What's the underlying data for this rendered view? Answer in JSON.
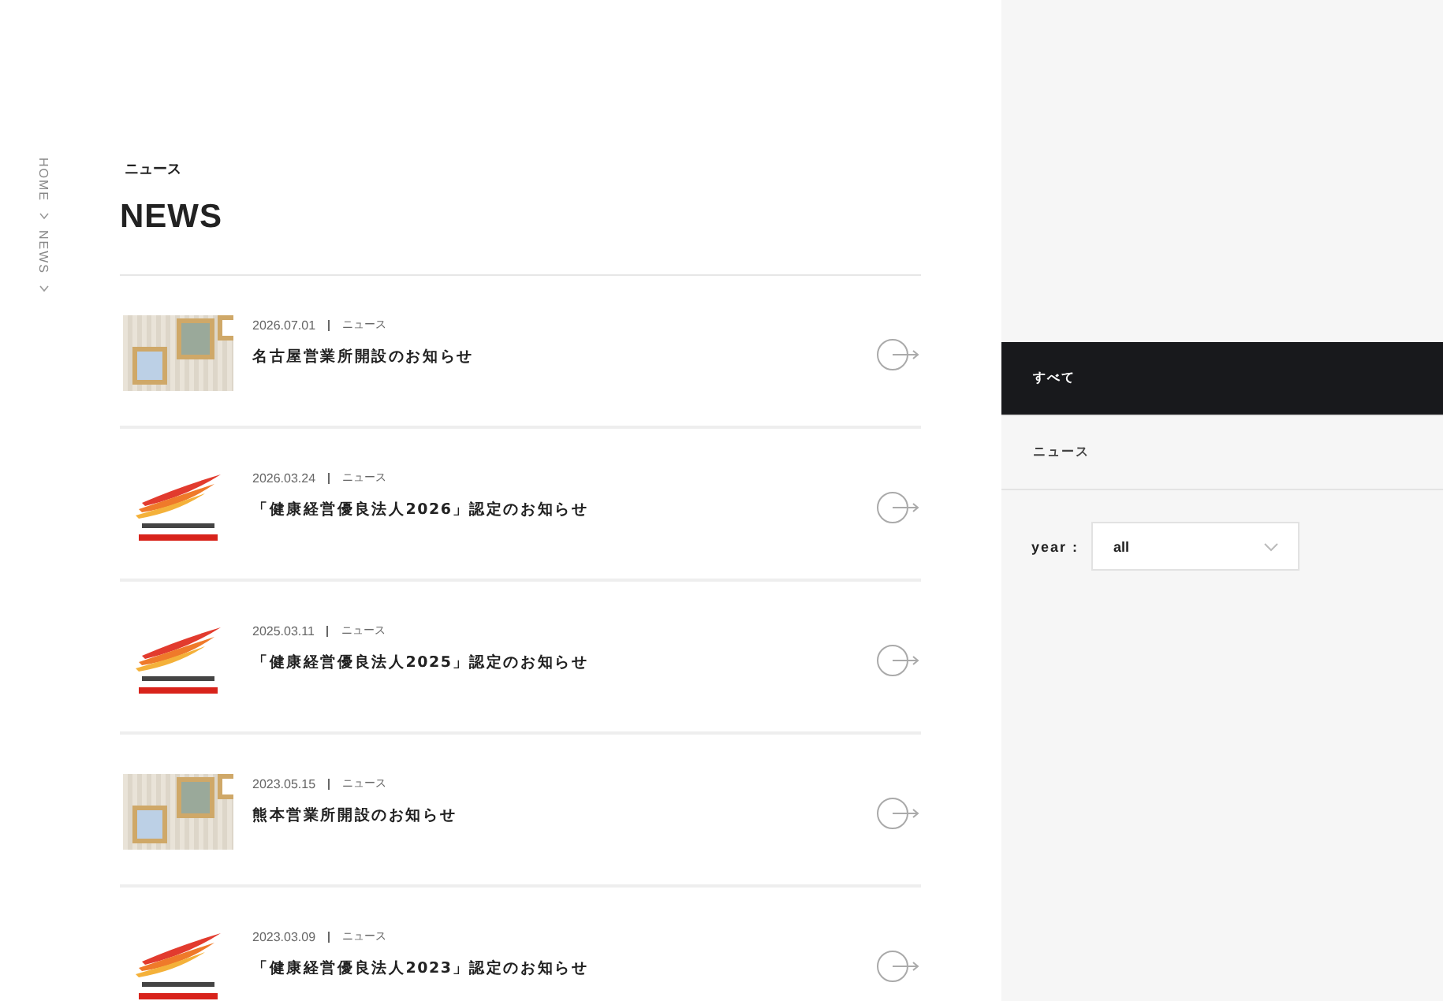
{
  "breadcrumb": [
    {
      "label": "HOME"
    },
    {
      "label": "NEWS"
    }
  ],
  "page_heading": {
    "subtitle": "ニュース",
    "title": "NEWS"
  },
  "news": [
    {
      "kind": "photo",
      "date": "2026.07.01",
      "category": "ニュース",
      "title": "名古屋営業所開設のお知らせ"
    },
    {
      "kind": "logo",
      "date": "2026.03.24",
      "category": "ニュース",
      "title": "「健康経営優良法人2026」認定のお知らせ"
    },
    {
      "kind": "logo",
      "date": "2025.03.11",
      "category": "ニュース",
      "title": "「健康経営優良法人2025」認定のお知らせ"
    },
    {
      "kind": "photo",
      "date": "2023.05.15",
      "category": "ニュース",
      "title": "熊本営業所開設のお知らせ"
    },
    {
      "kind": "logo",
      "date": "2023.03.09",
      "category": "ニュース",
      "title": "「健康経営優良法人2023」認定のお知らせ"
    }
  ],
  "sidebar": {
    "categories": [
      {
        "label": "すべて",
        "selected": true
      },
      {
        "label": "ニュース",
        "selected": false
      }
    ],
    "year_filter": {
      "label": "year :",
      "value": "all"
    }
  }
}
